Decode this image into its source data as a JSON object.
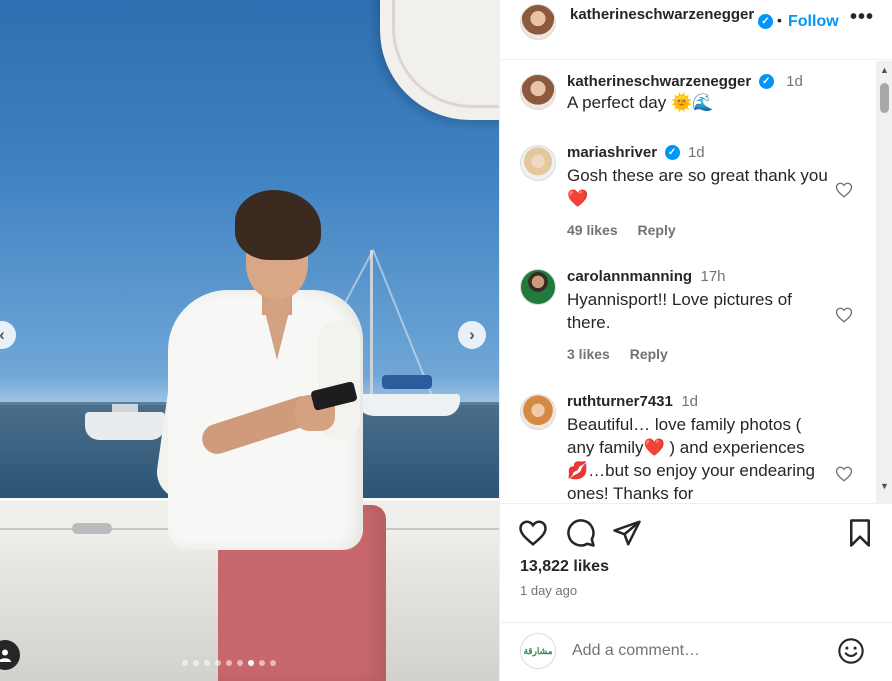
{
  "post": {
    "username": "katherineschwarzenegger",
    "follow_label": "Follow",
    "separator": "•",
    "more_label": "•••",
    "carousel": {
      "slide_count": 9,
      "active_index": 6,
      "prev_label": "‹",
      "next_label": "›"
    }
  },
  "caption": {
    "username": "katherineschwarzenegger",
    "time": "1d",
    "text": "A perfect day 🌞🌊"
  },
  "comments": [
    {
      "username": "mariashriver",
      "verified": true,
      "time": "1d",
      "text": "Gosh these are so great thank you",
      "emoji": "❤️",
      "likes": "49 likes",
      "reply": "Reply"
    },
    {
      "username": "carolannmanning",
      "verified": false,
      "time": "17h",
      "text": "Hyannisport!! Love pictures of there.",
      "likes": "3 likes",
      "reply": "Reply"
    },
    {
      "username": "ruthturner7431",
      "verified": false,
      "time": "1d",
      "text_a": "Beautiful… love family photos ( any family",
      "emoji_a": "❤️",
      "text_b": " ) and experiences ",
      "emoji_b": "💋",
      "text_c": "…but so enjoy your endearing ones! Thanks for"
    }
  ],
  "actions": {
    "likes": "13,822 likes",
    "time_ago": "1 day ago"
  },
  "composer": {
    "placeholder": "Add a comment…",
    "avatar_text": "مشارقة"
  },
  "icons": [
    "heart-icon",
    "comment-icon",
    "share-icon",
    "bookmark-icon",
    "emoji-icon",
    "more-icon",
    "verified-icon",
    "user-tag-icon"
  ],
  "colors": {
    "accent": "#0095f6",
    "text": "#262626",
    "muted": "#737373",
    "like_red": "#e5162c"
  }
}
